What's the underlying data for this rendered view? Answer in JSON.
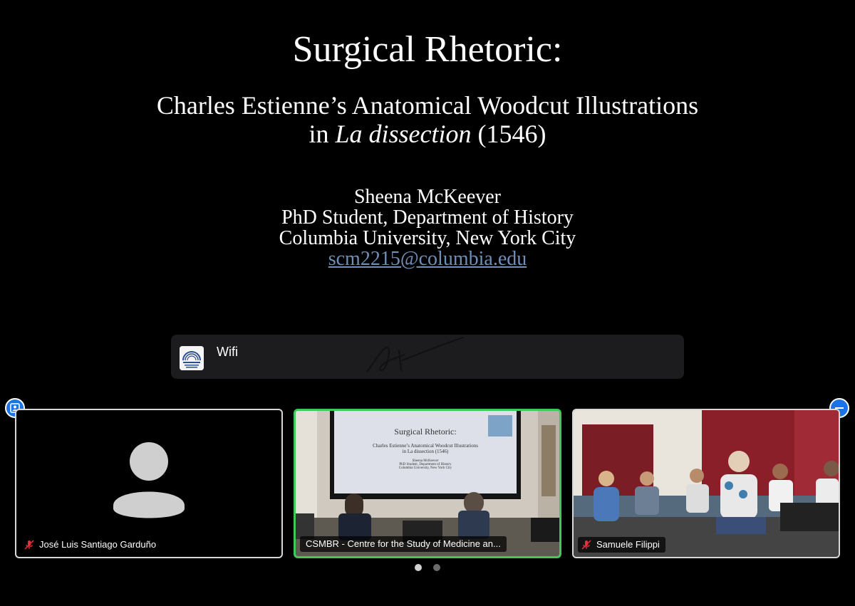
{
  "slide": {
    "title": "Surgical Rhetoric:",
    "subtitle_line1": "Charles Estienne’s Anatomical Woodcut Illustrations",
    "subtitle_line2_prefix": "in ",
    "subtitle_line2_italic": "La dissection",
    "subtitle_line2_suffix": " (1546)",
    "author_name": "Sheena McKeever",
    "author_role": "PhD Student, Department of History",
    "author_affiliation": "Columbia University, New York City",
    "author_email": "scm2215@columbia.edu"
  },
  "notification": {
    "text": "Wifi"
  },
  "participants": [
    {
      "name": "José Luis Santiago Garduño",
      "muted": true
    },
    {
      "name": "CSMBR - Centre for the Study of Medicine an...",
      "muted": false
    },
    {
      "name": "Samuele Filippi",
      "muted": true
    }
  ],
  "mini_slide": {
    "title": "Surgical Rhetoric:",
    "line1": "Charles Estienne’s Anatomical Woodcut Illustrations",
    "line2": "in La dissection (1546)",
    "line3": "Sheena McKeever",
    "line4": "PhD Student, Department of History",
    "line5": "Columbia University, New York City"
  },
  "icons": {
    "left_button": "person-frame-icon",
    "right_button": "minimize-icon",
    "mic": "mic-muted-icon"
  },
  "colors": {
    "active_speaker_border": "#3ec95a",
    "button_blue": "#1a73e8",
    "muted_mic": "#e5303a",
    "link": "#6f8fb8"
  },
  "pagination": {
    "pages": 2,
    "current": 1
  }
}
